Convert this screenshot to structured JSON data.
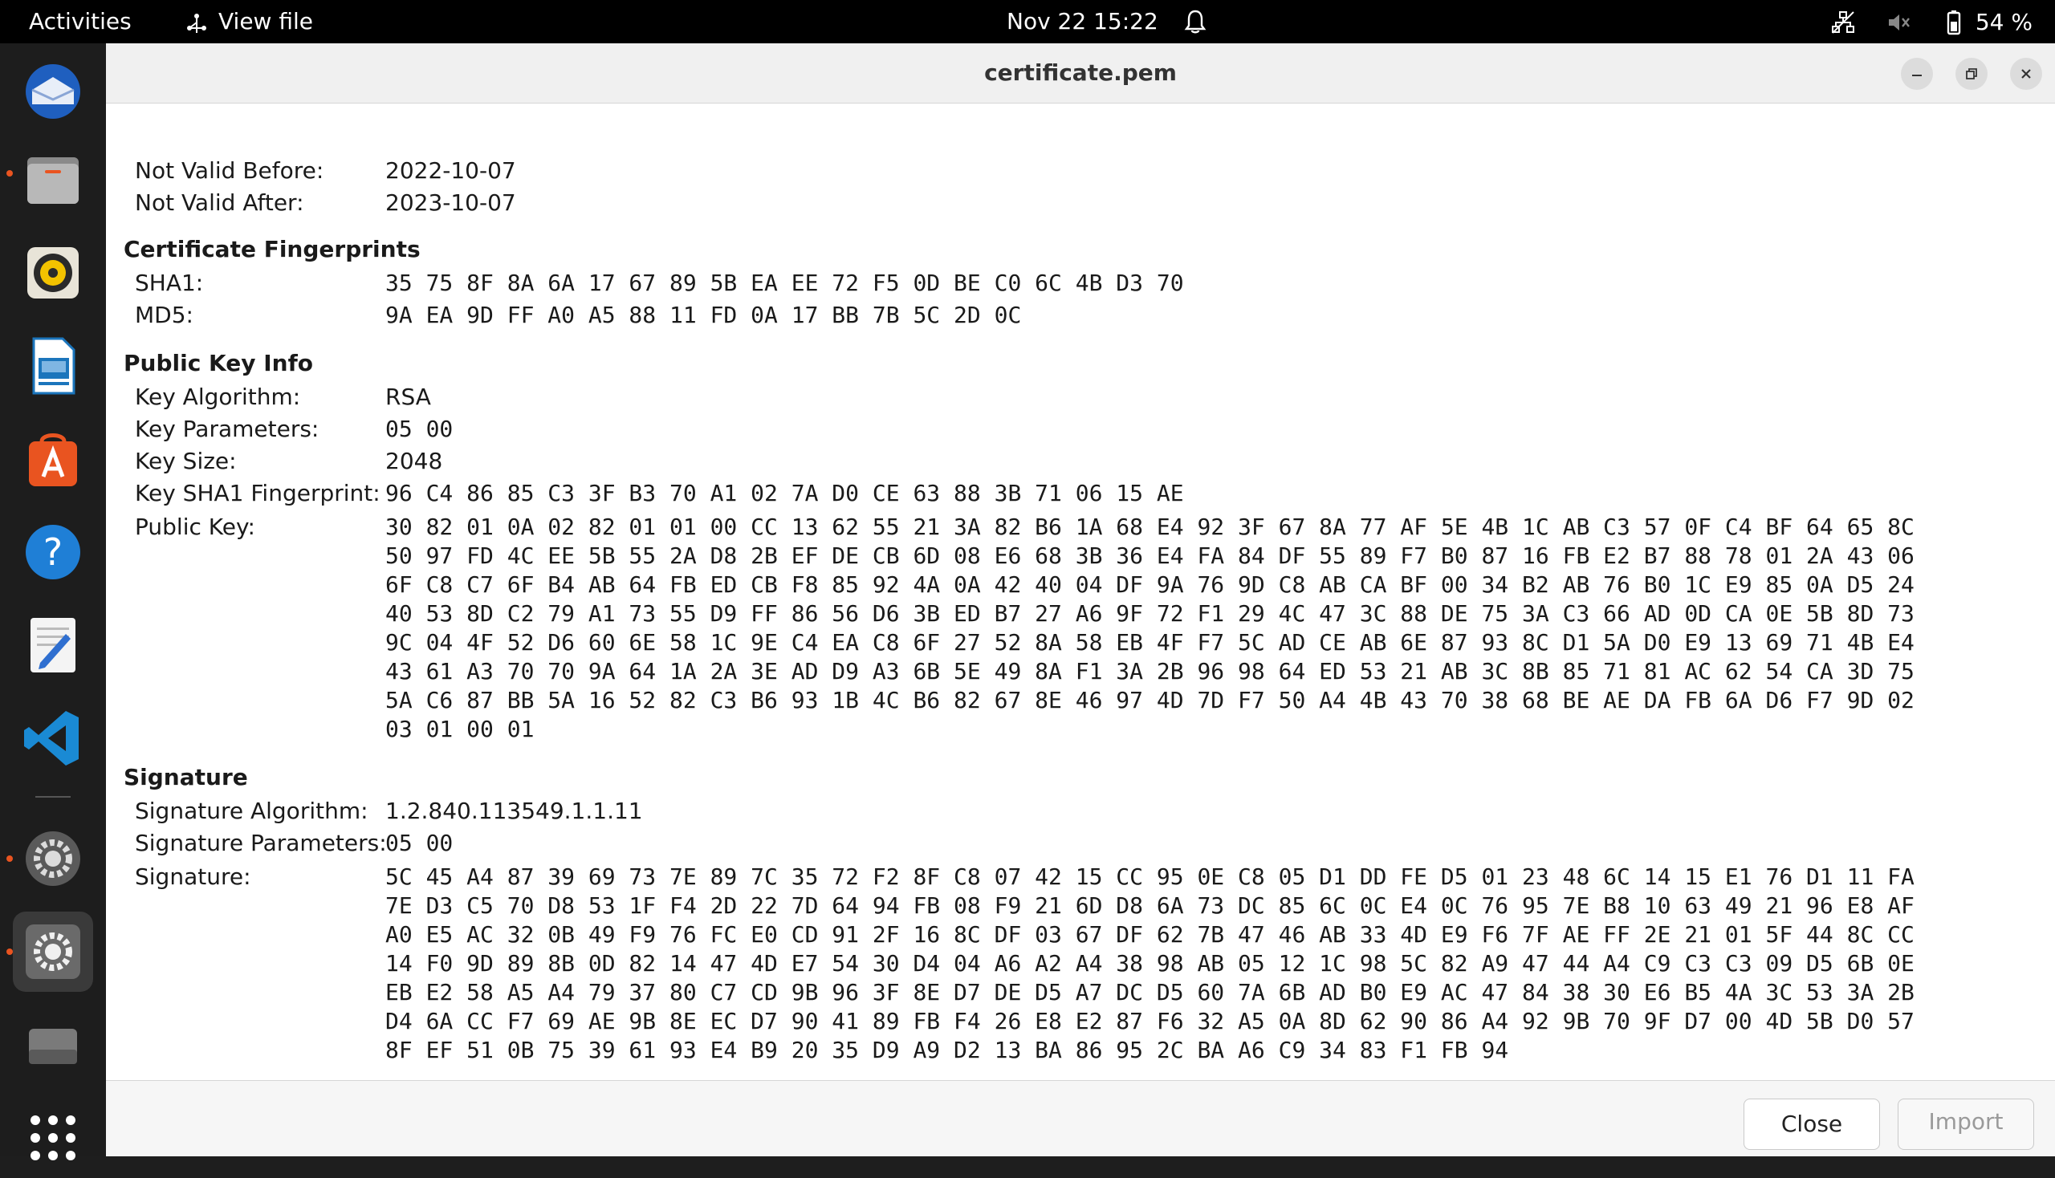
{
  "topbar": {
    "activities": "Activities",
    "app_menu": "View file",
    "app_menu_icon": "view-file-icon",
    "clock": "Nov 22  15:22",
    "battery": "54 %",
    "tray_icons": [
      "network-icon",
      "speaker-muted-icon",
      "battery-icon"
    ]
  },
  "dock": {
    "items": [
      "thunderbird-icon",
      "files-icon",
      "rhythmbox-icon",
      "libreoffice-impress-icon",
      "app-center-icon",
      "help-icon",
      "text-editor-icon",
      "vscode-icon",
      "settings-icon",
      "settings-active-icon",
      "drive-icon",
      "show-apps-icon"
    ]
  },
  "window": {
    "title": "certificate.pem"
  },
  "validity": {
    "not_before_label": "Not Valid Before:",
    "not_before": "2022-10-07",
    "not_after_label": "Not Valid After:",
    "not_after": "2023-10-07"
  },
  "fingerprints": {
    "title": "Certificate Fingerprints",
    "sha1_label": "SHA1:",
    "sha1": "35 75 8F 8A 6A 17 67 89 5B EA EE 72 F5 0D BE C0 6C 4B D3 70",
    "md5_label": "MD5:",
    "md5": "9A EA 9D FF A0 A5 88 11 FD 0A 17 BB 7B 5C 2D 0C"
  },
  "public_key": {
    "title": "Public Key Info",
    "algorithm_label": "Key Algorithm:",
    "algorithm": "RSA",
    "parameters_label": "Key Parameters:",
    "parameters": "05 00",
    "size_label": "Key Size:",
    "size": "2048",
    "sha1_label": "Key SHA1 Fingerprint:",
    "sha1": "96 C4 86 85 C3 3F B3 70 A1 02 7A D0 CE 63 88 3B 71 06 15 AE",
    "key_label": "Public Key:",
    "key_lines": [
      "30 82 01 0A 02 82 01 01 00 CC 13 62 55 21 3A 82 B6 1A 68 E4 92 3F 67 8A 77 AF 5E 4B 1C AB C3 57 0F C4 BF 64 65 8C",
      "50 97 FD 4C EE 5B 55 2A D8 2B EF DE CB 6D 08 E6 68 3B 36 E4 FA 84 DF 55 89 F7 B0 87 16 FB E2 B7 88 78 01 2A 43 06",
      "6F C8 C7 6F B4 AB 64 FB ED CB F8 85 92 4A 0A 42 40 04 DF 9A 76 9D C8 AB CA BF 00 34 B2 AB 76 B0 1C E9 85 0A D5 24",
      "40 53 8D C2 79 A1 73 55 D9 FF 86 56 D6 3B ED B7 27 A6 9F 72 F1 29 4C 47 3C 88 DE 75 3A C3 66 AD 0D CA 0E 5B 8D 73",
      "9C 04 4F 52 D6 60 6E 58 1C 9E C4 EA C8 6F 27 52 8A 58 EB 4F F7 5C AD CE AB 6E 87 93 8C D1 5A D0 E9 13 69 71 4B E4",
      "43 61 A3 70 70 9A 64 1A 2A 3E AD D9 A3 6B 5E 49 8A F1 3A 2B 96 98 64 ED 53 21 AB 3C 8B 85 71 81 AC 62 54 CA 3D 75",
      "5A C6 87 BB 5A 16 52 82 C3 B6 93 1B 4C B6 82 67 8E 46 97 4D 7D F7 50 A4 4B 43 70 38 68 BE AE DA FB 6A D6 F7 9D 02",
      "03 01 00 01"
    ]
  },
  "signature": {
    "title": "Signature",
    "algorithm_label": "Signature Algorithm:",
    "algorithm": "1.2.840.113549.1.1.11",
    "parameters_label": "Signature Parameters:",
    "parameters": "05 00",
    "sig_label": "Signature:",
    "sig_lines": [
      "5C 45 A4 87 39 69 73 7E 89 7C 35 72 F2 8F C8 07 42 15 CC 95 0E C8 05 D1 DD FE D5 01 23 48 6C 14 15 E1 76 D1 11 FA",
      "7E D3 C5 70 D8 53 1F F4 2D 22 7D 64 94 FB 08 F9 21 6D D8 6A 73 DC 85 6C 0C E4 0C 76 95 7E B8 10 63 49 21 96 E8 AF",
      "A0 E5 AC 32 0B 49 F9 76 FC E0 CD 91 2F 16 8C DF 03 67 DF 62 7B 47 46 AB 33 4D E9 F6 7F AE FF 2E 21 01 5F 44 8C CC",
      "14 F0 9D 89 8B 0D 82 14 47 4D E7 54 30 D4 04 A6 A2 A4 38 98 AB 05 12 1C 98 5C 82 A9 47 44 A4 C9 C3 C3 09 D5 6B 0E",
      "EB E2 58 A5 A4 79 37 80 C7 CD 9B 96 3F 8E D7 DE D5 A7 DC D5 60 7A 6B AD B0 E9 AC 47 84 38 30 E6 B5 4A 3C 53 3A 2B",
      "D4 6A CC F7 69 AE 9B 8E EC D7 90 41 89 FB F4 26 E8 E2 87 F6 32 A5 0A 8D 62 90 86 A4 92 9B 70 9F D7 00 4D 5B D0 57",
      "8F EF 51 0B 75 39 61 93 E4 B9 20 35 D9 A9 D2 13 BA 86 95 2C BA A6 C9 34 83 F1 FB 94"
    ]
  },
  "footer": {
    "close_label": "Close",
    "import_label": "Import"
  }
}
